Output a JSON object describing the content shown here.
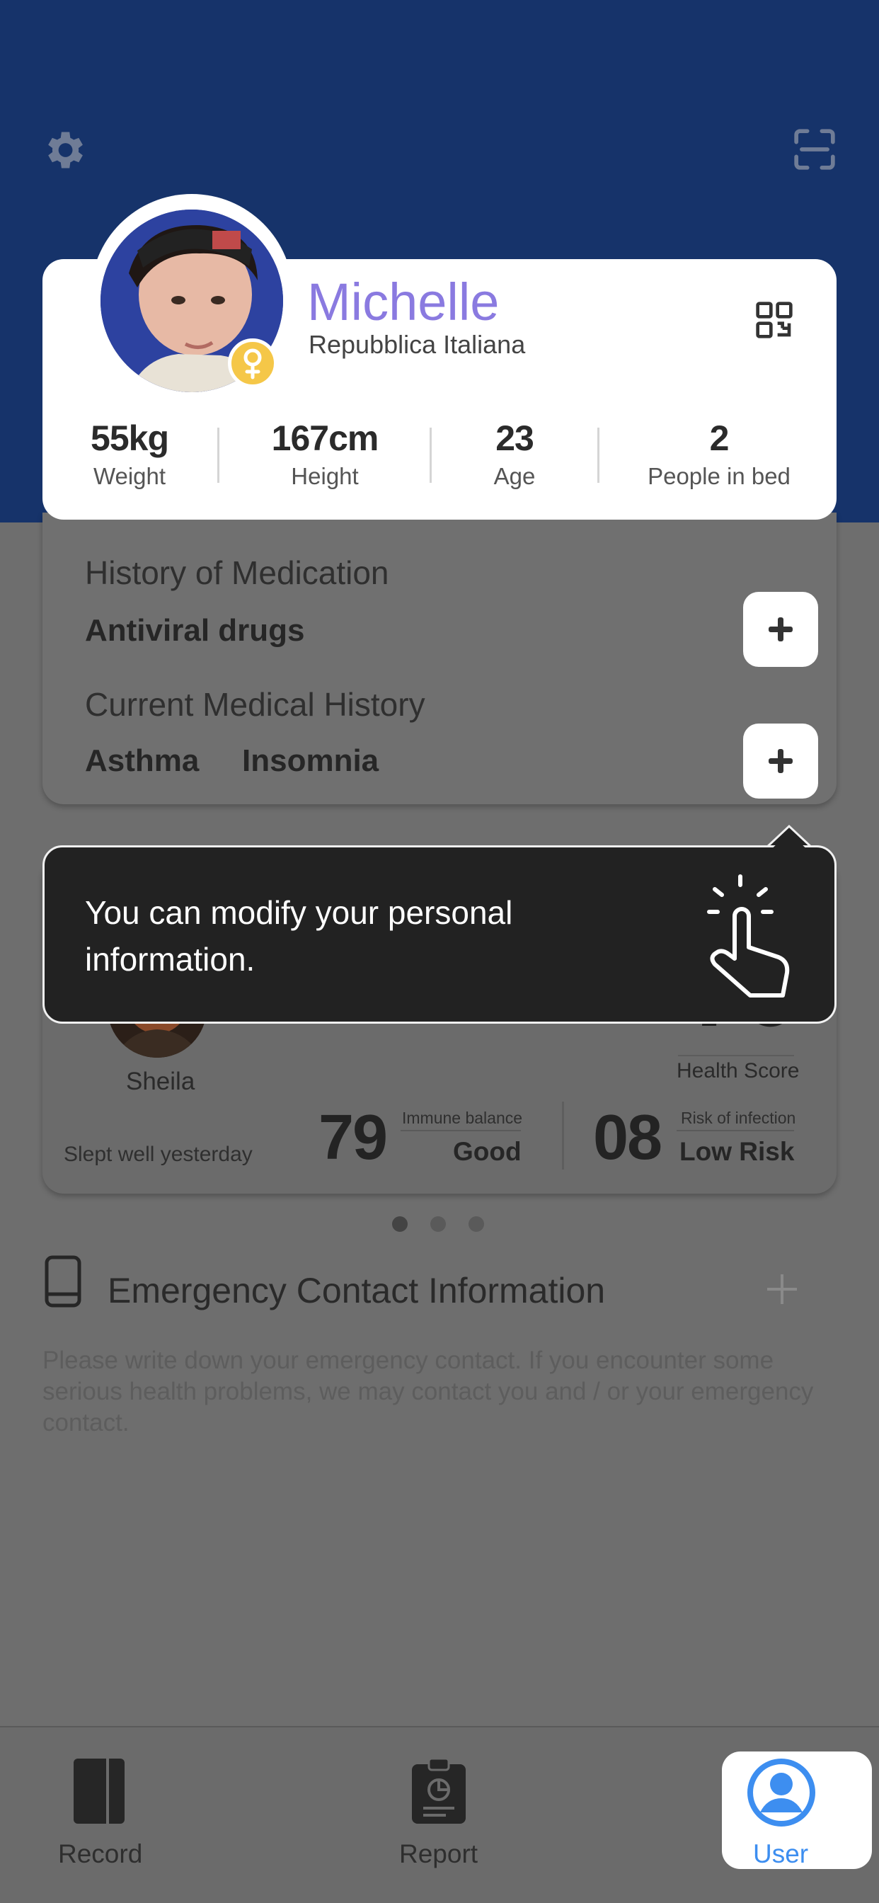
{
  "profile": {
    "name": "Michelle",
    "country": "Repubblica Italiana",
    "gender": "female",
    "stats": [
      {
        "value": "55kg",
        "label": "Weight"
      },
      {
        "value": "167cm",
        "label": "Height"
      },
      {
        "value": "23",
        "label": "Age"
      },
      {
        "value": "2",
        "label": "People in bed"
      }
    ]
  },
  "medical": {
    "medication_label": "History of Medication",
    "medication_value": "Antiviral drugs",
    "history_label": "Current Medical History",
    "history_values": [
      "Asthma",
      "Insomnia"
    ]
  },
  "tooltip": {
    "text": "You can modify your personal information."
  },
  "sleep": {
    "name": "Sheila",
    "health_score_label": "Health Score",
    "status": "Slept well yesterday",
    "immune": {
      "number": "79",
      "label": "Immune balance",
      "value": "Good"
    },
    "infection": {
      "number": "08",
      "label": "Risk of infection",
      "value": "Low Risk"
    },
    "page_dots": 3,
    "active_dot": 0
  },
  "emergency": {
    "title": "Emergency Contact Information",
    "description": "Please write down your emergency contact. If you encounter some serious health problems, we may contact you and / or your emergency contact."
  },
  "nav": [
    {
      "label": "Record",
      "icon": "record-icon"
    },
    {
      "label": "Report",
      "icon": "report-icon"
    },
    {
      "label": "User",
      "icon": "user-icon",
      "active": true
    }
  ],
  "colors": {
    "header": "#16336a",
    "name_accent": "#8a7ae0",
    "active_nav": "#3d8ef0",
    "gender_badge": "#f5c748"
  }
}
